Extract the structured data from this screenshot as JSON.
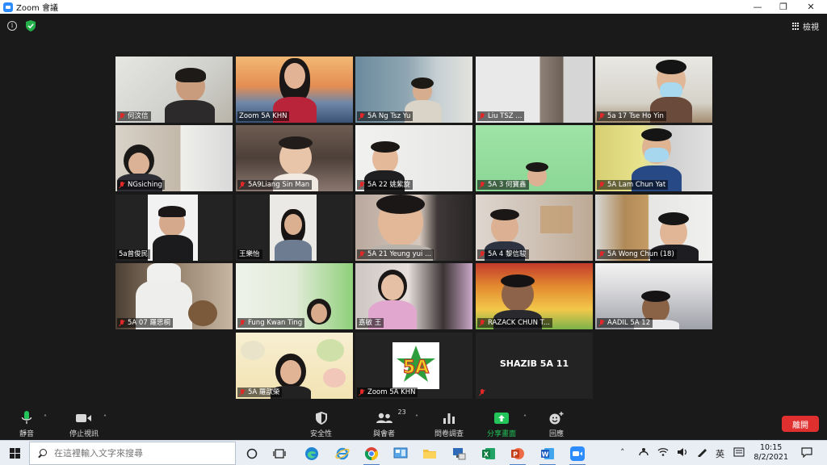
{
  "window": {
    "title": "Zoom 會議",
    "controls": {
      "minimize": "—",
      "restore": "❐",
      "close": "✕"
    }
  },
  "header": {
    "view_label": "檢視"
  },
  "participants": [
    {
      "name": "何汶信",
      "muted": true
    },
    {
      "name": "Zoom 5A KHN",
      "muted": false
    },
    {
      "name": "5A Ng Tsz Yu",
      "muted": true
    },
    {
      "name": "Liu      TSZ                ...",
      "muted": true
    },
    {
      "name": "5a 17 Tse Ho Yin",
      "muted": true
    },
    {
      "name": "NGsiching",
      "muted": true
    },
    {
      "name": "5A9Liang Sin Man",
      "muted": true
    },
    {
      "name": "5A 22 姚紫旋",
      "muted": true
    },
    {
      "name": "5A 3  何寶鑫",
      "muted": true
    },
    {
      "name": "5A Lam Chun Yat",
      "muted": true
    },
    {
      "name": "5a曾俊民",
      "muted": false
    },
    {
      "name": "王樂怡",
      "muted": false
    },
    {
      "name": "5A 21 Yeung yui ...",
      "muted": true
    },
    {
      "name": "5A 4  黎信駿",
      "muted": true
    },
    {
      "name": "5A  Wong Chun (18)",
      "muted": true
    },
    {
      "name": "5A 07  羅思桐",
      "muted": true
    },
    {
      "name": "Fung Kwan Ting",
      "muted": true
    },
    {
      "name": "嘉敏 王",
      "muted": false
    },
    {
      "name": "RAZACK CHUN T...",
      "muted": true
    },
    {
      "name": "AADIL 5A 12",
      "muted": true
    },
    {
      "name": "5A 羅歆榮",
      "muted": true
    },
    {
      "name": "Zoom 5A KHN",
      "muted": true
    },
    {
      "name": "SHAZIB 5A 11",
      "muted": true
    }
  ],
  "badge_text": "5A",
  "toolbar": {
    "mute": "靜音",
    "stop_video": "停止視訊",
    "security": "安全性",
    "participants": "與會者",
    "participants_count": "23",
    "polls": "問卷調查",
    "share": "分享畫面",
    "reactions": "回應",
    "leave": "離開"
  },
  "taskbar": {
    "search_placeholder": "在這裡輸入文字來搜尋",
    "tray_ime": "英",
    "time": "10:15",
    "date": "8/2/2021"
  },
  "colors": {
    "meeting_bg": "#1a1a1a",
    "active_speaker": "#d6d63c",
    "muted_red": "#e02828",
    "leave_red": "#e02f2f",
    "share_green": "#23c45a"
  }
}
